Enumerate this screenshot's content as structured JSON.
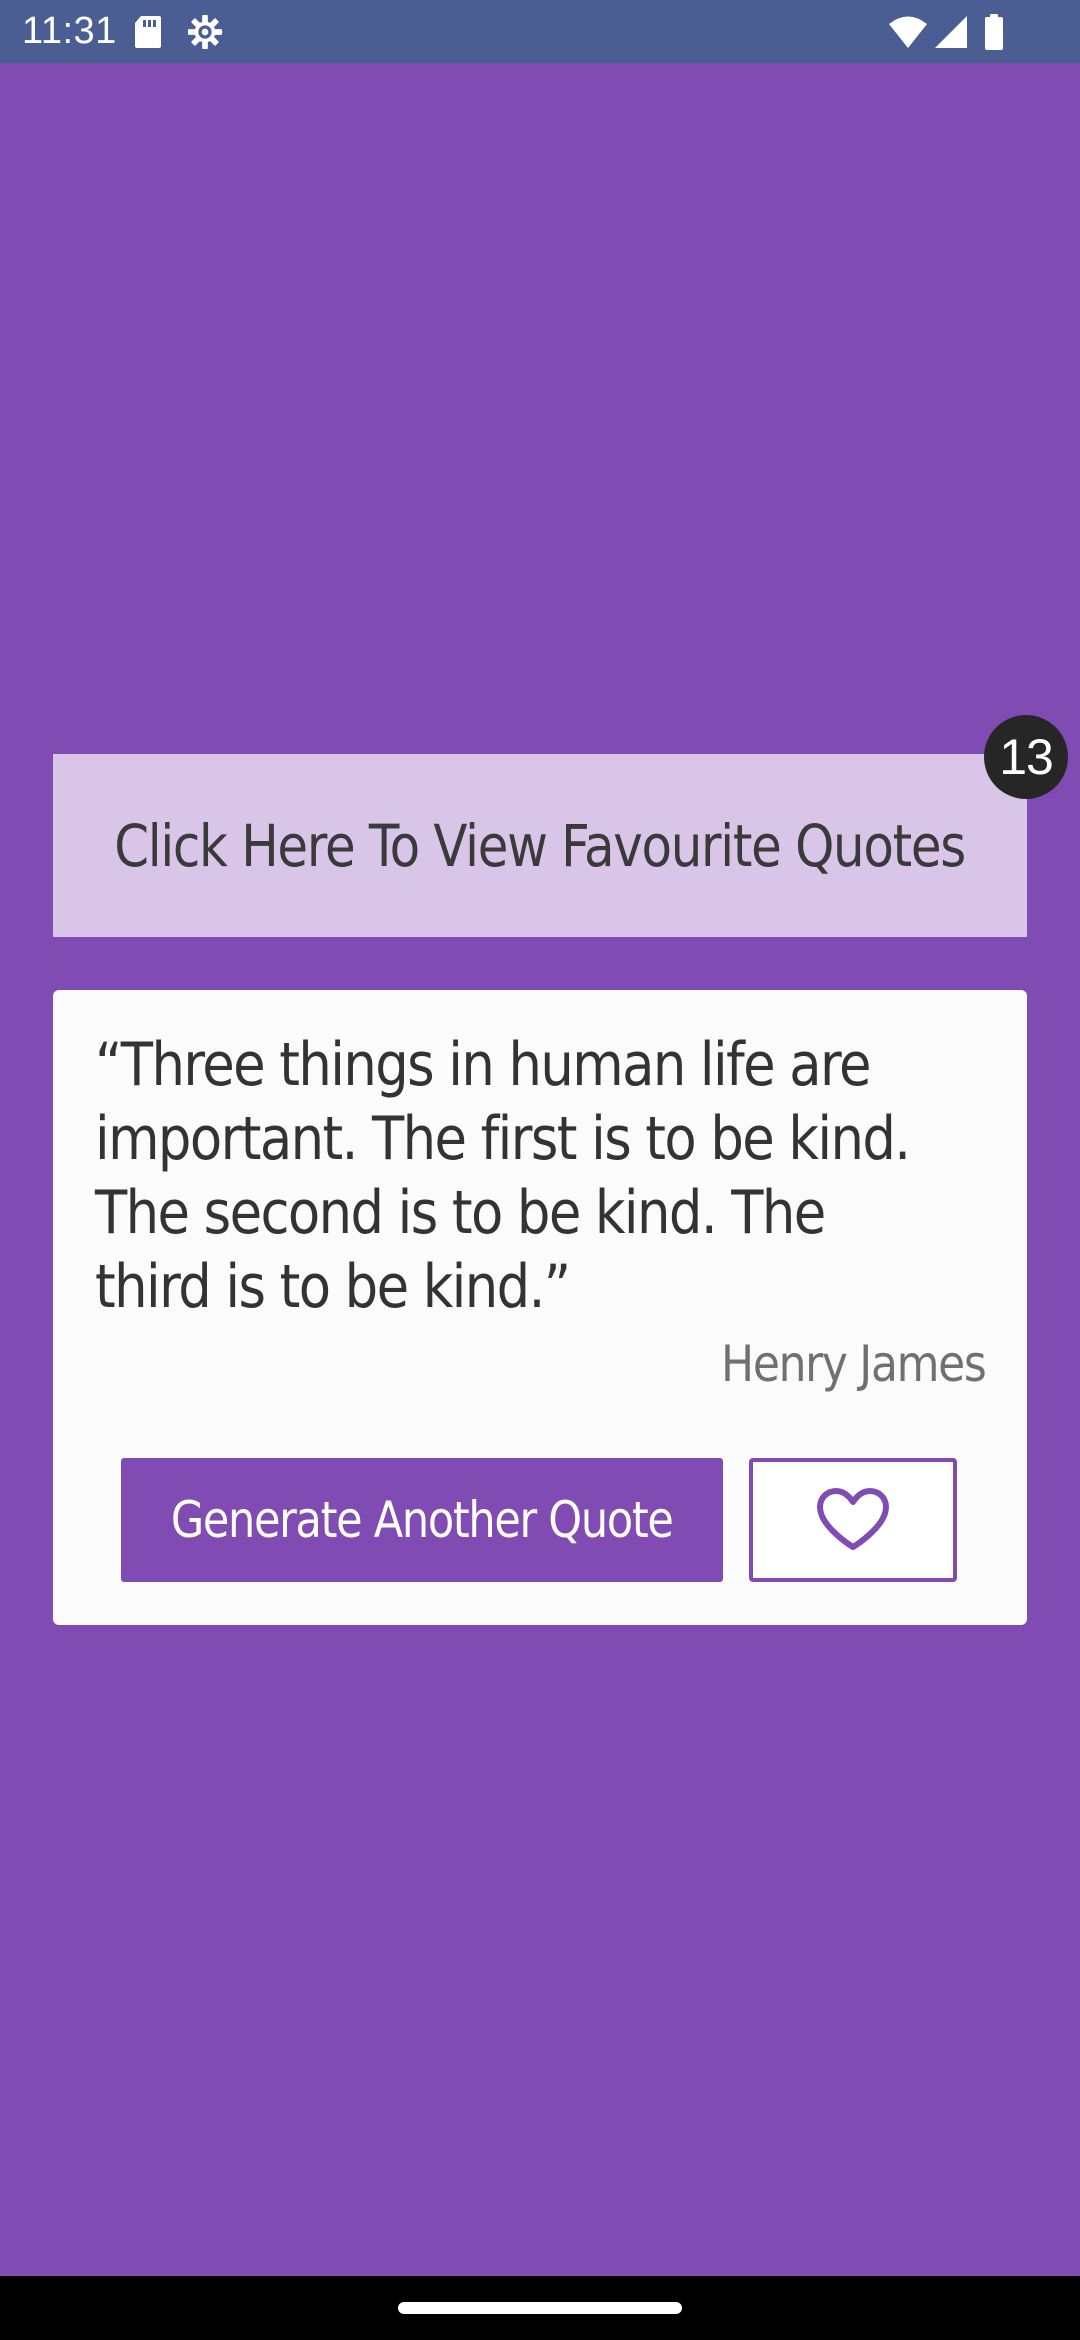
{
  "status_bar": {
    "time": "11:31",
    "icons": [
      "sd-card-icon",
      "settings-gear-icon",
      "wifi-icon",
      "cellular-signal-icon",
      "battery-icon"
    ]
  },
  "favourites": {
    "banner_label": "Click Here To View Favourite Quotes",
    "count": "13"
  },
  "quote": {
    "text": "“Three things in human life are important. The first is to be kind. The second is to be kind. The third is to be kind.”",
    "author": "Henry James"
  },
  "actions": {
    "generate_label": "Generate Another Quote",
    "favourite_icon": "heart-outline-icon"
  },
  "colors": {
    "background": "#804bb2",
    "status_bar": "#4b5e94",
    "banner": "#d8c5e7",
    "card": "#fbfbfb",
    "badge": "#262626",
    "accent": "#804bb2"
  }
}
